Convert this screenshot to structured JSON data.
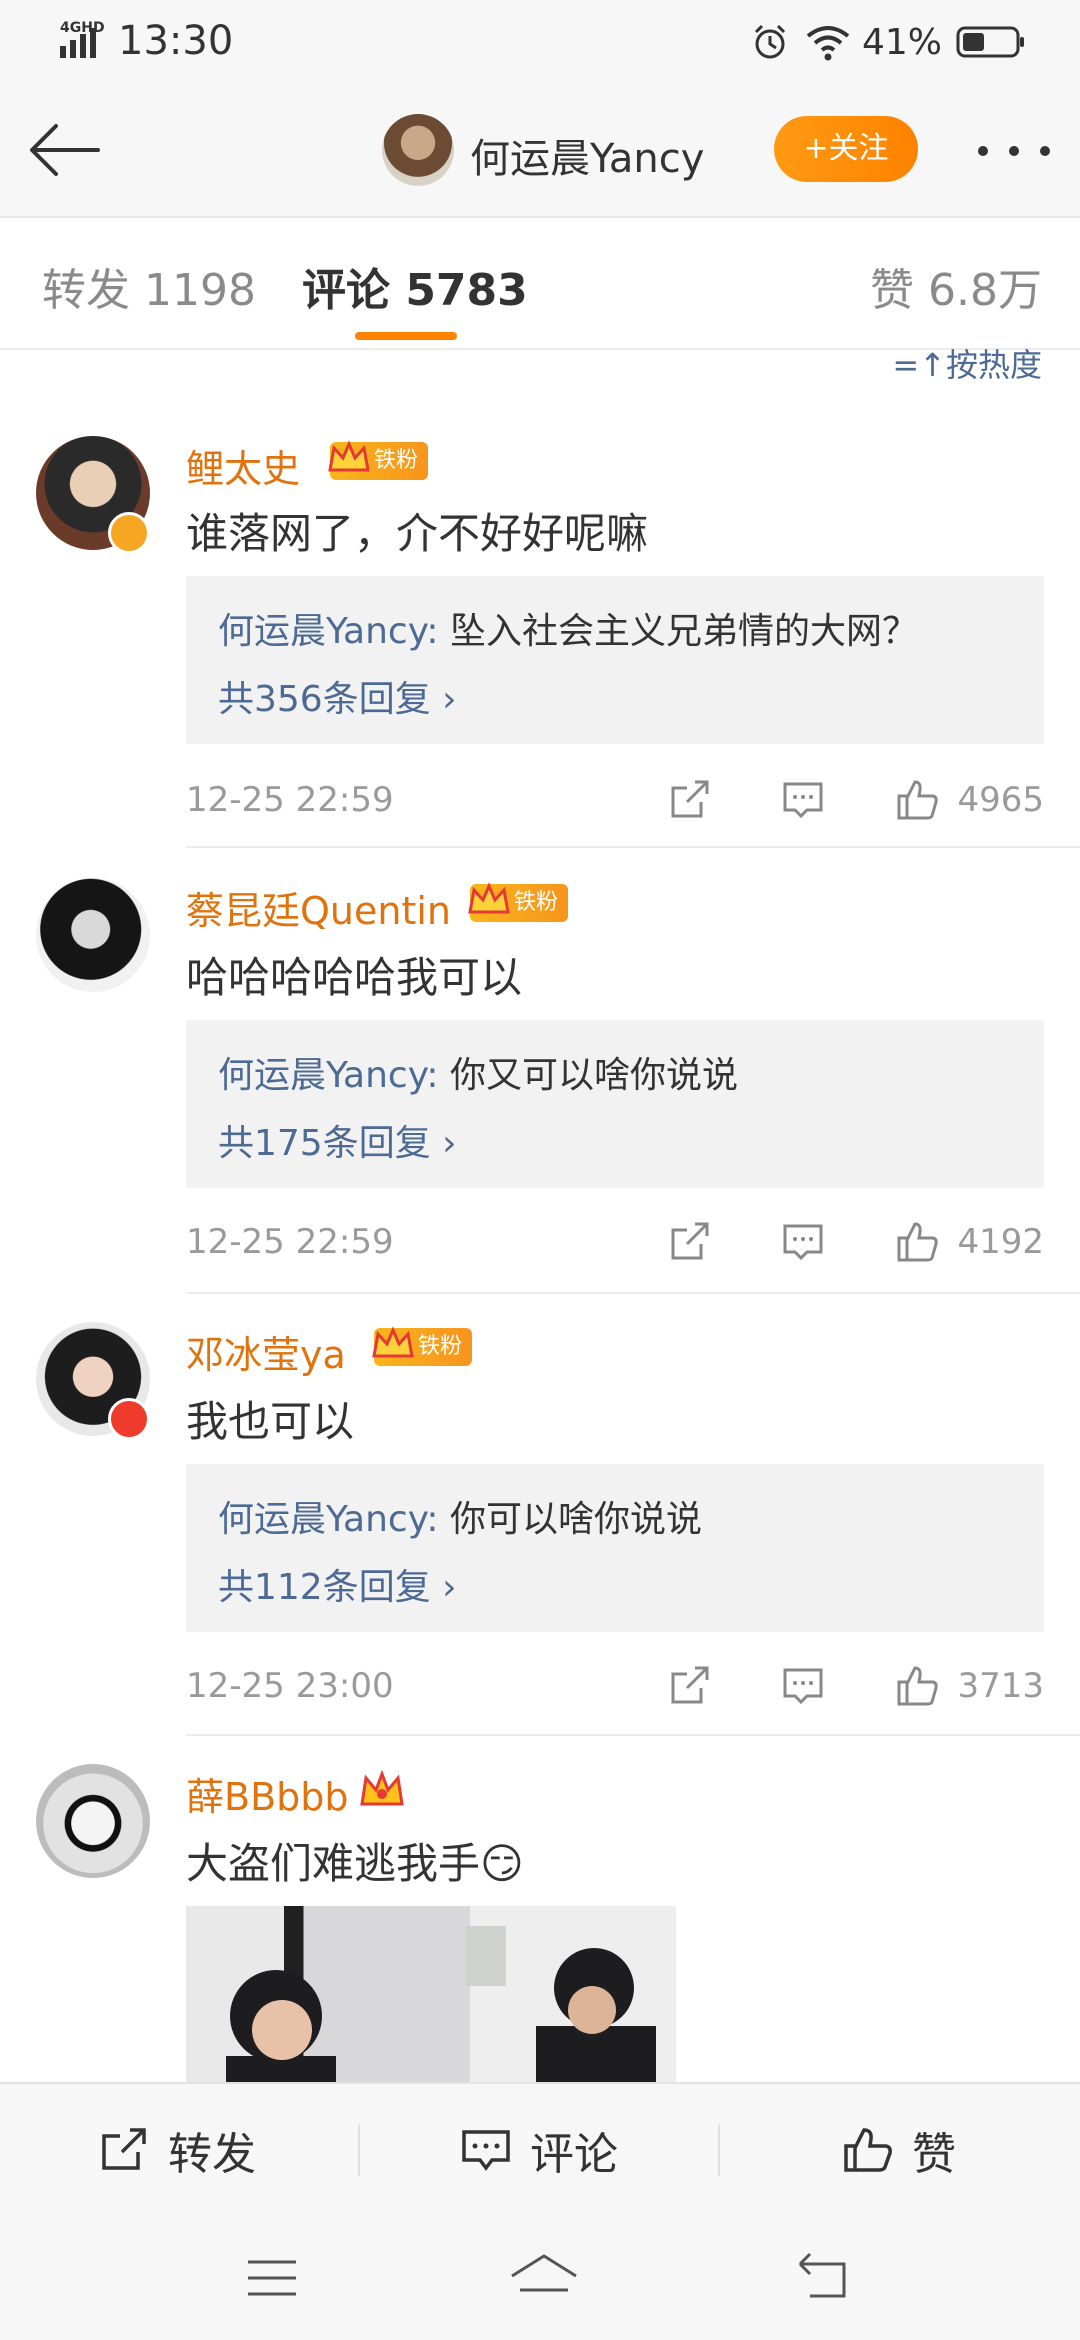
{
  "status_bar": {
    "network": "4GHD",
    "time": "13:30",
    "battery_pct": "41%",
    "battery_level": 0.41
  },
  "nav": {
    "title": "何运晨Yancy",
    "follow_label": "+关注"
  },
  "tabs": [
    {
      "label": "转发 1198"
    },
    {
      "label": "评论 5783",
      "active": true
    },
    {
      "label": "赞 6.8万"
    }
  ],
  "sort_label": "=↑按热度",
  "comments": [
    {
      "name": "鲤太史",
      "badge": "铁粉",
      "text": "谁落网了，介不好好呢嘛",
      "reply_author": "何运晨Yancy:",
      "reply_text": " 坠入社会主义兄弟情的大网？",
      "reply_count": "共356条回复 ›",
      "time": "12-25 22:59",
      "likes": "4965"
    },
    {
      "name": "蔡昆廷Quentin",
      "badge": "铁粉",
      "text": "哈哈哈哈哈我可以",
      "reply_author": "何运晨Yancy:",
      "reply_text": " 你又可以啥你说说",
      "reply_count": "共175条回复 ›",
      "time": "12-25 22:59",
      "likes": "4192"
    },
    {
      "name": "邓冰莹ya",
      "badge": "铁粉",
      "text": "我也可以",
      "reply_author": "何运晨Yancy:",
      "reply_text": " 你可以啥你说说",
      "reply_count": "共112条回复 ›",
      "time": "12-25 23:00",
      "likes": "3713"
    },
    {
      "name": "薛BBbbb",
      "text": "大盗们难逃我手😏"
    }
  ],
  "bottom_bar": {
    "repost": "转发",
    "comment": "评论",
    "like": "赞"
  },
  "colors": {
    "accent": "#ff8200",
    "username": "#e0730e",
    "link": "#4d6a94"
  }
}
